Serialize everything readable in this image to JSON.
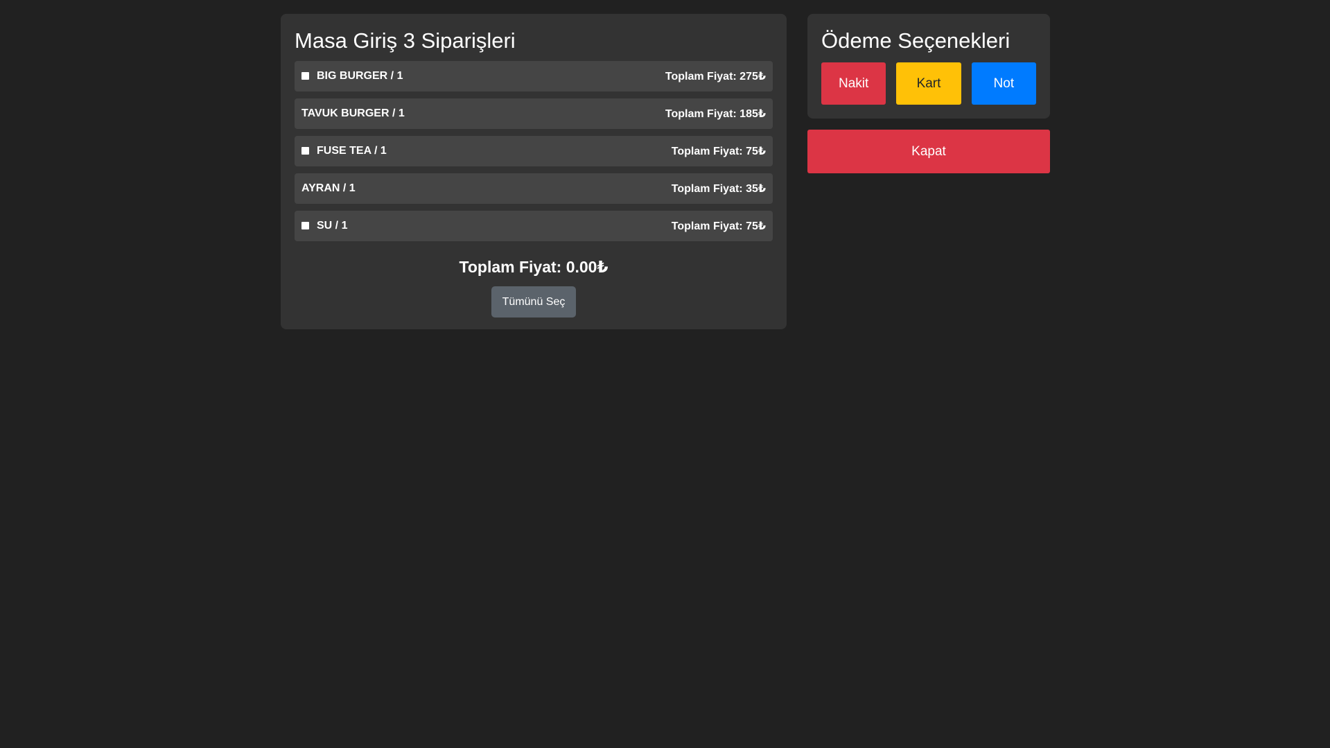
{
  "orders_panel": {
    "title": "Masa Giriş 3 Siparişleri",
    "items": [
      {
        "name": "BIG BURGER / 1",
        "price": "Toplam Fiyat: 275₺",
        "has_checkbox": true
      },
      {
        "name": "TAVUK BURGER / 1",
        "price": "Toplam Fiyat: 185₺",
        "has_checkbox": false
      },
      {
        "name": "FUSE TEA / 1",
        "price": "Toplam Fiyat: 75₺",
        "has_checkbox": true
      },
      {
        "name": "AYRAN / 1",
        "price": "Toplam Fiyat: 35₺",
        "has_checkbox": false
      },
      {
        "name": "SU / 1",
        "price": "Toplam Fiyat: 75₺",
        "has_checkbox": true
      }
    ],
    "total": "Toplam Fiyat: 0.00₺",
    "select_all_label": "Tümünü Seç"
  },
  "payment_panel": {
    "title": "Ödeme Seçenekleri",
    "buttons": [
      {
        "label": "Nakit",
        "color": "#dc3545",
        "text_color": "#ffffff"
      },
      {
        "label": "Kart",
        "color": "#ffc107",
        "text_color": "#212529"
      },
      {
        "label": "Not",
        "color": "#007bff",
        "text_color": "#ffffff"
      }
    ]
  },
  "close_button": {
    "label": "Kapat",
    "color": "#dc3545"
  }
}
